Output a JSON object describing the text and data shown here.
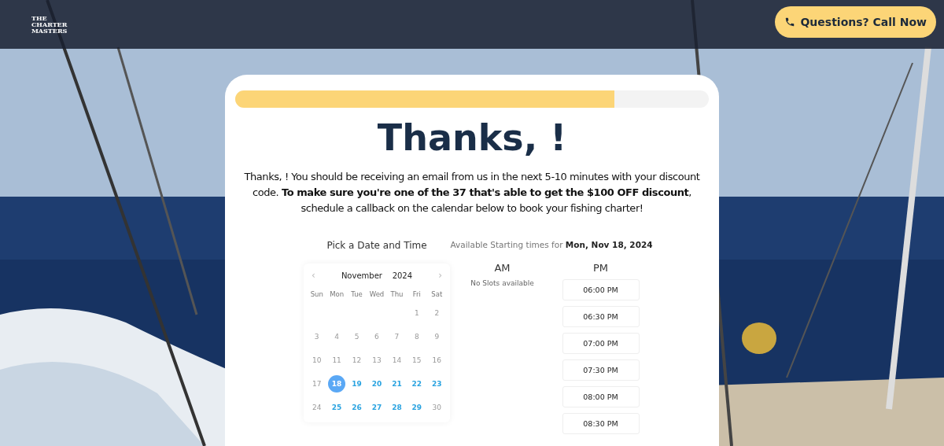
{
  "header": {
    "logo": [
      "THE",
      "CHARTER",
      "MASTERS"
    ],
    "call_button": "Questions? Call Now"
  },
  "progress": {
    "level": 0.8
  },
  "title": "Thanks, !",
  "message": "Thanks, ! You should be receiving an email from us in the next 5-10 minutes with your discount code. **To make sure you're one of the 37 that's able to get the $100 OFF discount**, schedule a callback on the calendar below to book your fishing charter!",
  "calendar": {
    "heading": "Pick a Date and Time",
    "prev": "‹",
    "next": "›",
    "month": "November",
    "year": "2024",
    "weekdays": [
      "Sun",
      "Mon",
      "Tue",
      "Wed",
      "Thu",
      "Fri",
      "Sat"
    ],
    "weeks": [
      [
        {
          "day": "1",
          "disabled": true,
          "selected": false
        },
        {
          "day": "2",
          "disabled": true,
          "selected": false
        }
      ],
      [
        {
          "day": "3",
          "disabled": true,
          "selected": false
        },
        {
          "day": "4",
          "disabled": true,
          "selected": false
        },
        {
          "day": "5",
          "disabled": true,
          "selected": false
        },
        {
          "day": "6",
          "disabled": true,
          "selected": false
        },
        {
          "day": "7",
          "disabled": true,
          "selected": false
        },
        {
          "day": "8",
          "disabled": true,
          "selected": false
        },
        {
          "day": "9",
          "disabled": true,
          "selected": false
        }
      ],
      [
        {
          "day": "10",
          "disabled": true,
          "selected": false
        },
        {
          "day": "11",
          "disabled": true,
          "selected": false
        },
        {
          "day": "12",
          "disabled": true,
          "selected": false
        },
        {
          "day": "13",
          "disabled": true,
          "selected": false
        },
        {
          "day": "14",
          "disabled": true,
          "selected": false
        },
        {
          "day": "15",
          "disabled": true,
          "selected": false
        },
        {
          "day": "16",
          "disabled": true,
          "selected": false
        }
      ],
      [
        {
          "day": "17",
          "disabled": true,
          "selected": false
        },
        {
          "day": "18",
          "disabled": false,
          "selected": true
        },
        {
          "day": "19",
          "disabled": false,
          "selected": false
        },
        {
          "day": "20",
          "disabled": false,
          "selected": false
        },
        {
          "day": "21",
          "disabled": false,
          "selected": false
        },
        {
          "day": "22",
          "disabled": false,
          "selected": false
        },
        {
          "day": "23",
          "disabled": false,
          "selected": false
        }
      ],
      [
        {
          "day": "24",
          "disabled": true,
          "selected": false
        },
        {
          "day": "25",
          "disabled": false,
          "selected": false
        },
        {
          "day": "26",
          "disabled": false,
          "selected": false
        },
        {
          "day": "27",
          "disabled": false,
          "selected": false
        },
        {
          "day": "28",
          "disabled": false,
          "selected": false
        },
        {
          "day": "29",
          "disabled": false,
          "selected": false
        },
        {
          "day": "30",
          "disabled": true,
          "selected": false
        }
      ]
    ]
  },
  "times": {
    "heading_prefix": "Available Starting times for",
    "heading_date": "Mon, Nov 18, 2024",
    "am": {
      "label": "AM",
      "empty": "No Slots available"
    },
    "pm": {
      "label": "PM",
      "slots": [
        "06:00 PM",
        "06:30 PM",
        "07:00 PM",
        "07:30 PM",
        "08:00 PM",
        "08:30 PM"
      ]
    }
  }
}
